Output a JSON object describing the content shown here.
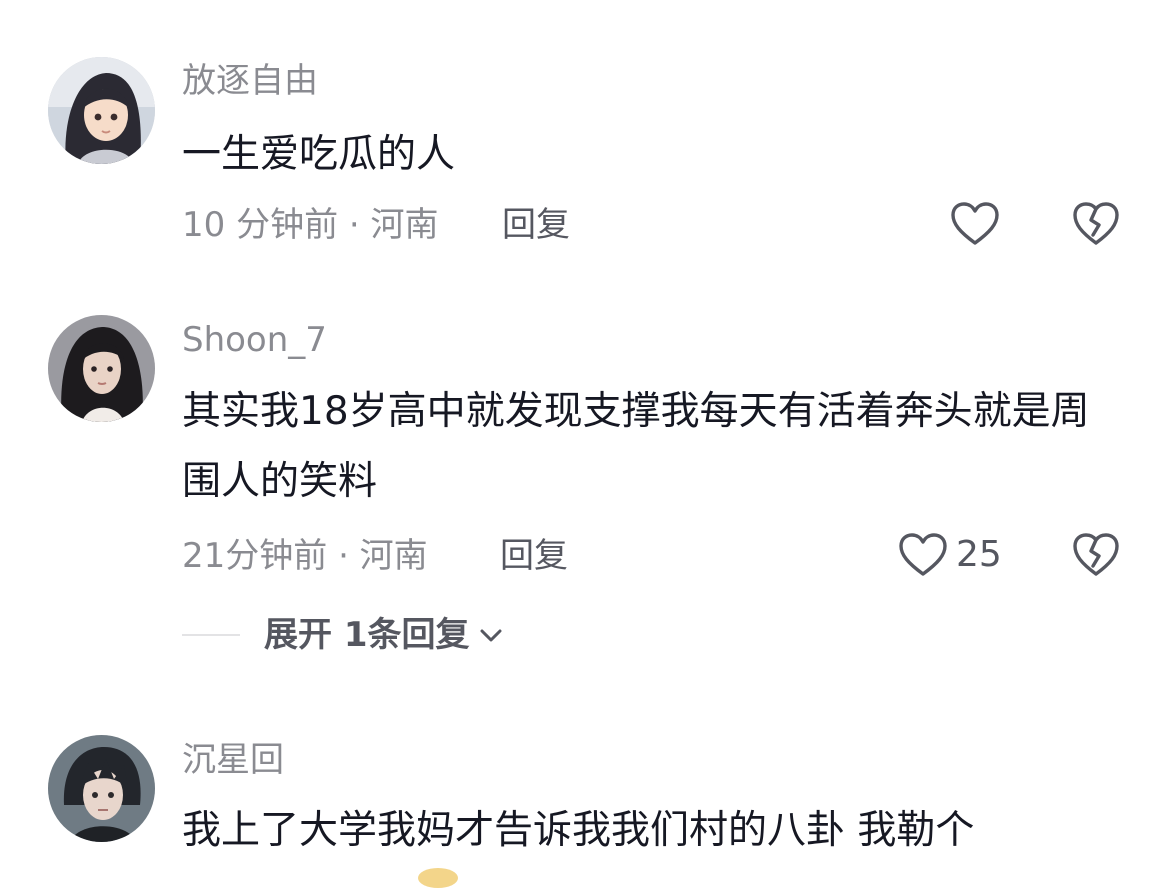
{
  "comments": [
    {
      "username": "放逐自由",
      "text": "一生爱吃瓜的人",
      "meta": "10 分钟前 · 河南",
      "reply_label": "回复",
      "likes": "",
      "avatar_icon": "avatar-anime-girl"
    },
    {
      "username": "Shoon_7",
      "text": "其实我18岁高中就发现支撑我每天有活着奔头就是周围人的笑料",
      "meta": "21分钟前 · 河南",
      "reply_label": "回复",
      "likes": "25",
      "avatar_icon": "avatar-woman-photo",
      "expand_label": "展开 1条回复"
    },
    {
      "username": "沉星回",
      "text": "我上了大学我妈才告诉我我们村的八卦 我勒个",
      "avatar_icon": "avatar-anime-boy"
    }
  ],
  "icons": {
    "like": "heart-outline-icon",
    "dislike": "broken-heart-icon",
    "expand": "chevron-down-icon"
  },
  "colors": {
    "primary_text": "#161823",
    "secondary_text": "#8a8b91",
    "action_text": "#555760"
  }
}
